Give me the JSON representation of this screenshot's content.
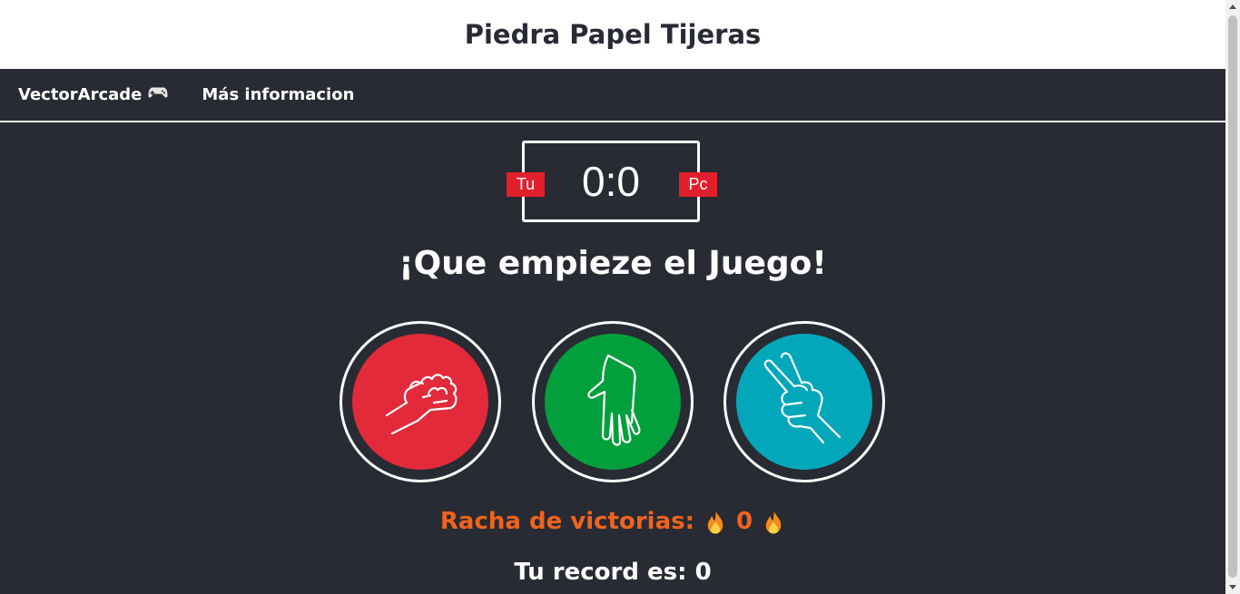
{
  "header": {
    "title": "Piedra Papel Tijeras"
  },
  "nav": {
    "brand": "VectorArcade",
    "brand_icon": "gamepad-icon",
    "info_link": "Más informacion"
  },
  "scoreboard": {
    "player_label": "Tu",
    "pc_label": "Pc",
    "score": "0:0"
  },
  "message": "¡Que empieze el Juego!",
  "choices": [
    {
      "name": "piedra",
      "icon": "fist-icon",
      "color": "#e22a3b"
    },
    {
      "name": "papel",
      "icon": "open-hand-icon",
      "color": "#02a03c"
    },
    {
      "name": "tijeras",
      "icon": "peace-hand-icon",
      "color": "#02a8ba"
    }
  ],
  "streak": {
    "label": "Racha de victorias:",
    "value": "0",
    "icon": "fire-icon"
  },
  "record": {
    "label": "Tu record es:",
    "value": "0"
  },
  "colors": {
    "background": "#282b33",
    "accent": "#e2202c",
    "streak": "#f0641f"
  }
}
